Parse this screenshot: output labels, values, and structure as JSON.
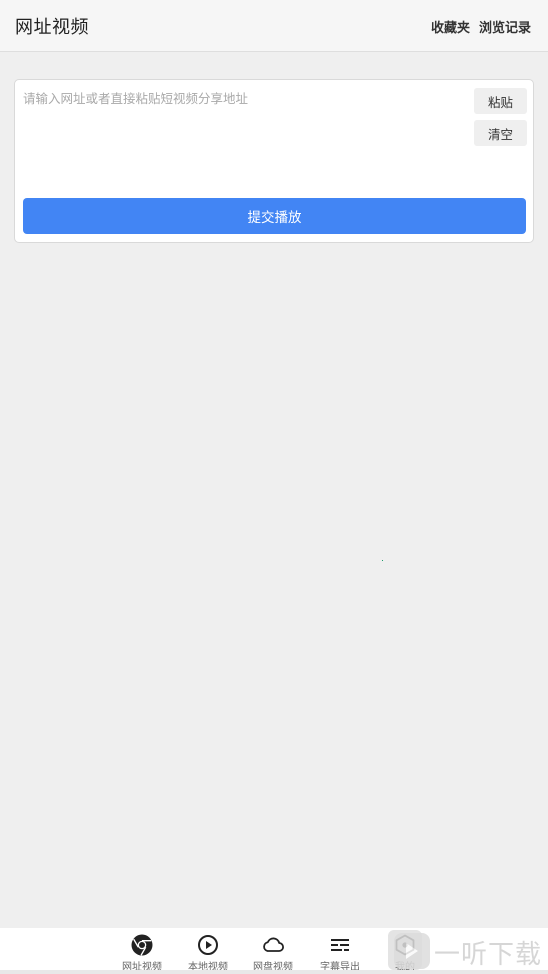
{
  "header": {
    "title": "网址视频",
    "favorites_label": "收藏夹",
    "history_label": "浏览记录"
  },
  "input_card": {
    "placeholder": "请输入网址或者直接粘贴短视频分享地址",
    "value": "",
    "paste_label": "粘贴",
    "clear_label": "清空",
    "submit_label": "提交播放"
  },
  "bottom_nav": {
    "items": [
      {
        "label": "网址视频",
        "icon": "chrome-icon"
      },
      {
        "label": "本地视频",
        "icon": "play-circle-icon"
      },
      {
        "label": "网盘视频",
        "icon": "cloud-icon"
      },
      {
        "label": "字幕导出",
        "icon": "subtitle-icon"
      },
      {
        "label": "我的",
        "icon": "hexagon-user-icon"
      }
    ]
  },
  "watermark": {
    "text": "一听下载"
  },
  "colors": {
    "accent": "#4285f4",
    "background": "#efefef",
    "header_bg": "#f6f6f6"
  }
}
